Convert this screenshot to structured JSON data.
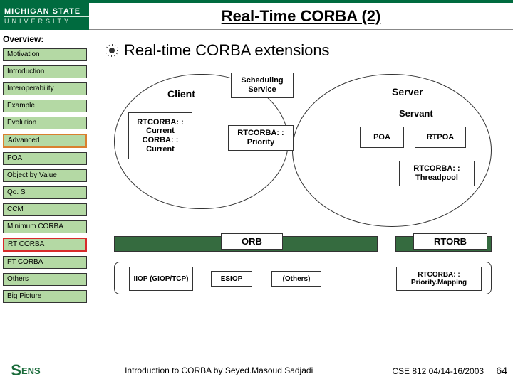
{
  "brand": {
    "top": "MICHIGAN STATE",
    "bottom": "UNIVERSITY"
  },
  "title": "Real-Time CORBA (2)",
  "sidebar": {
    "heading": "Overview:",
    "items": [
      {
        "label": "Motivation"
      },
      {
        "label": "Introduction"
      },
      {
        "label": "Interoperability"
      },
      {
        "label": "Example"
      },
      {
        "label": "Evolution"
      },
      {
        "label": "Advanced",
        "hi": 1
      },
      {
        "label": "POA"
      },
      {
        "label": "Object by Value"
      },
      {
        "label": "Qo. S"
      },
      {
        "label": "CCM"
      },
      {
        "label": "Minimum CORBA"
      },
      {
        "label": "RT CORBA",
        "hi": 2
      },
      {
        "label": "FT CORBA"
      },
      {
        "label": "Others"
      },
      {
        "label": "Big Picture"
      }
    ]
  },
  "bullet": "Real-time CORBA extensions",
  "diagram": {
    "client_label": "Client",
    "server_label": "Server",
    "scheduling": "Scheduling Service",
    "rtcorba_current": "RTCORBA: : Current CORBA: : Current",
    "rtcorba_priority": "RTCORBA: : Priority",
    "servant": "Servant",
    "poa": "POA",
    "rtpoa": "RTPOA",
    "threadpool": "RTCORBA: : Threadpool",
    "orb": "ORB",
    "rtorb": "RTORB",
    "iiop": "IIOP (GIOP/TCP)",
    "esiop": "ESIOP",
    "others": "(Others)",
    "priority_mapping": "RTCORBA: : Priority.Mapping"
  },
  "footer": {
    "logo": "SENS",
    "center": "Introduction to CORBA by Seyed.Masoud Sadjadi",
    "course": "CSE 812  04/14-16/2003",
    "page": "64"
  }
}
